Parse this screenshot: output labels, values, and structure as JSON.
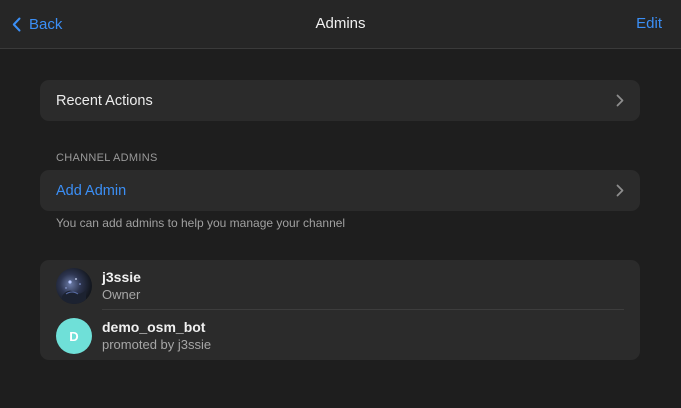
{
  "header": {
    "back_label": "Back",
    "title": "Admins",
    "edit_label": "Edit"
  },
  "recent_actions": {
    "label": "Recent Actions"
  },
  "channel_admins": {
    "section_label": "CHANNEL ADMINS",
    "add_admin_label": "Add Admin",
    "hint": "You can add admins to help you manage your channel"
  },
  "admins": [
    {
      "name": "j3ssie",
      "role": "Owner",
      "avatar": "photo"
    },
    {
      "name": "demo_osm_bot",
      "role": "promoted by j3ssie",
      "avatar_letter": "D",
      "avatar_color": "#6fe0d8"
    }
  ],
  "colors": {
    "accent": "#3b8ff6",
    "background": "#1e1e1e",
    "card": "#2b2b2b"
  },
  "icons": {
    "back": "chevron-left-icon",
    "row": "chevron-right-icon"
  }
}
